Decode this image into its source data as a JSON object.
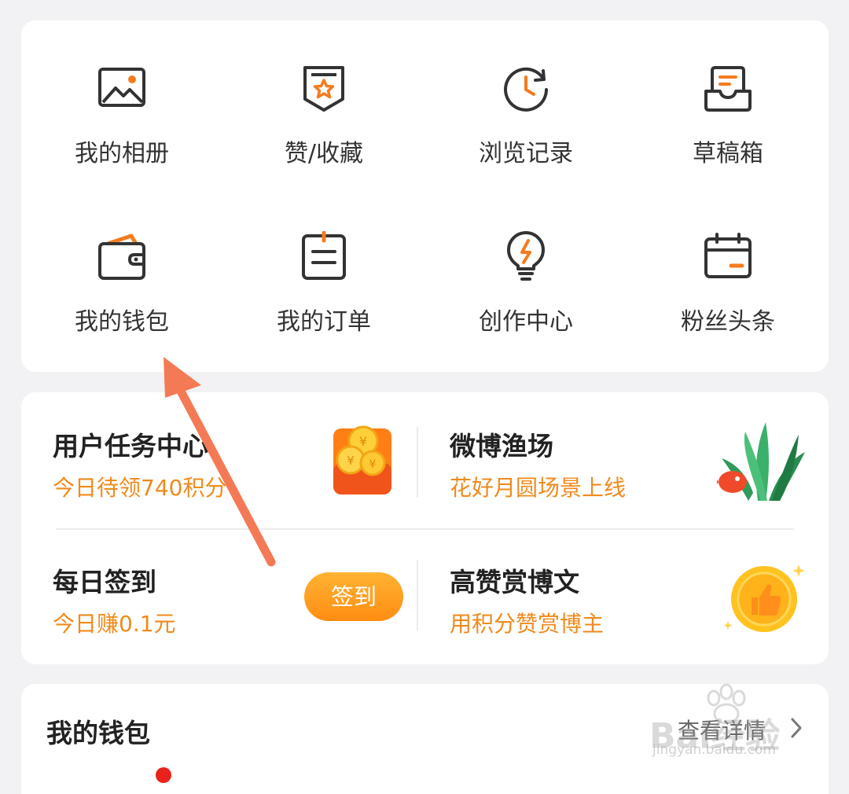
{
  "grid": {
    "items": [
      {
        "label": "我的相册",
        "icon": "photo-album-icon"
      },
      {
        "label": "赞/收藏",
        "icon": "favorites-badge-icon"
      },
      {
        "label": "浏览记录",
        "icon": "history-clock-icon"
      },
      {
        "label": "草稿箱",
        "icon": "draft-box-icon"
      },
      {
        "label": "我的钱包",
        "icon": "wallet-icon"
      },
      {
        "label": "我的订单",
        "icon": "order-list-icon"
      },
      {
        "label": "创作中心",
        "icon": "lightbulb-icon"
      },
      {
        "label": "粉丝头条",
        "icon": "calendar-icon"
      }
    ]
  },
  "tasks": {
    "user_task": {
      "title": "用户任务中心",
      "subtitle": "今日待领740积分",
      "icon": "coin-bag-icon"
    },
    "fishing": {
      "title": "微博渔场",
      "subtitle": "花好月圆场景上线",
      "icon": "aquarium-plant-icon"
    },
    "checkin": {
      "title": "每日签到",
      "subtitle": "今日赚0.1元",
      "button_label": "签到"
    },
    "reward": {
      "title": "高赞赏博文",
      "subtitle": "用积分赞赏博主",
      "icon": "thumbs-up-coin-icon"
    }
  },
  "wallet": {
    "title": "我的钱包",
    "more_label": "查看详情"
  },
  "watermark": {
    "text": "Bai经验",
    "domain": "jingyan.baidu.com"
  },
  "colors": {
    "accent_orange": "#f08a1c",
    "icon_orange": "#f57b1f",
    "icon_dark": "#333333",
    "card_bg": "#ffffff",
    "page_bg": "#f2f2f4",
    "annotation_arrow": "#f47a55"
  }
}
